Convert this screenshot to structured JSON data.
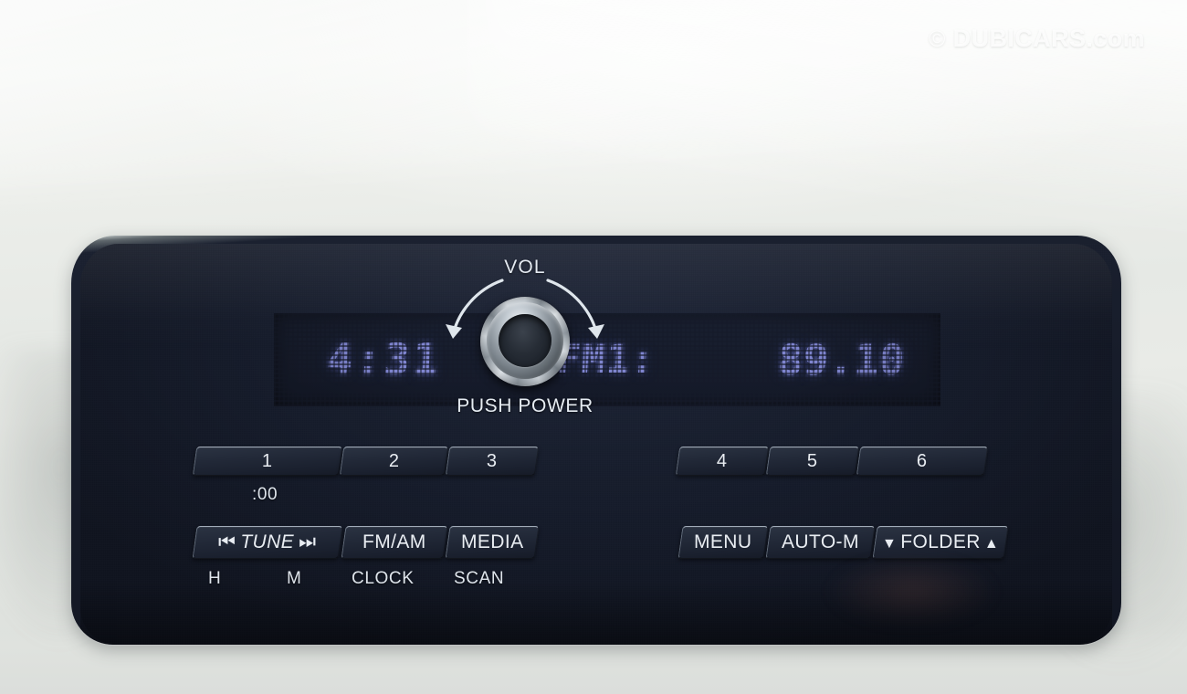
{
  "watermark": {
    "symbol": "©",
    "text": "DUBICARS.com"
  },
  "display": {
    "clock": "4:31",
    "band": "FM1:",
    "frequency": "89.10",
    "segment_color": "#7f85cf",
    "panel_color": "#171d2d"
  },
  "presets": {
    "left": [
      {
        "label": "1",
        "name": "preset-1"
      },
      {
        "label": "2",
        "name": "preset-2"
      },
      {
        "label": "3",
        "name": "preset-3"
      }
    ],
    "right": [
      {
        "label": "4",
        "name": "preset-4"
      },
      {
        "label": "5",
        "name": "preset-5"
      },
      {
        "label": "6",
        "name": "preset-6"
      }
    ],
    "preset_1_sublabel": ":00"
  },
  "function_buttons": {
    "tune": {
      "label": "TUNE",
      "prev_icon": "⏮",
      "next_icon": "⏭"
    },
    "fm_am": {
      "label": "FM/AM"
    },
    "media": {
      "label": "MEDIA"
    },
    "menu": {
      "label": "MENU"
    },
    "auto_m": {
      "label": "AUTO-M"
    },
    "folder": {
      "label": "FOLDER",
      "down_icon": "▼",
      "up_icon": "▲"
    }
  },
  "sublabels": {
    "hour": "H",
    "minute": "M",
    "clock": "CLOCK",
    "scan": "SCAN"
  },
  "volume": {
    "label": "VOL",
    "push_label": "PUSH POWER"
  }
}
